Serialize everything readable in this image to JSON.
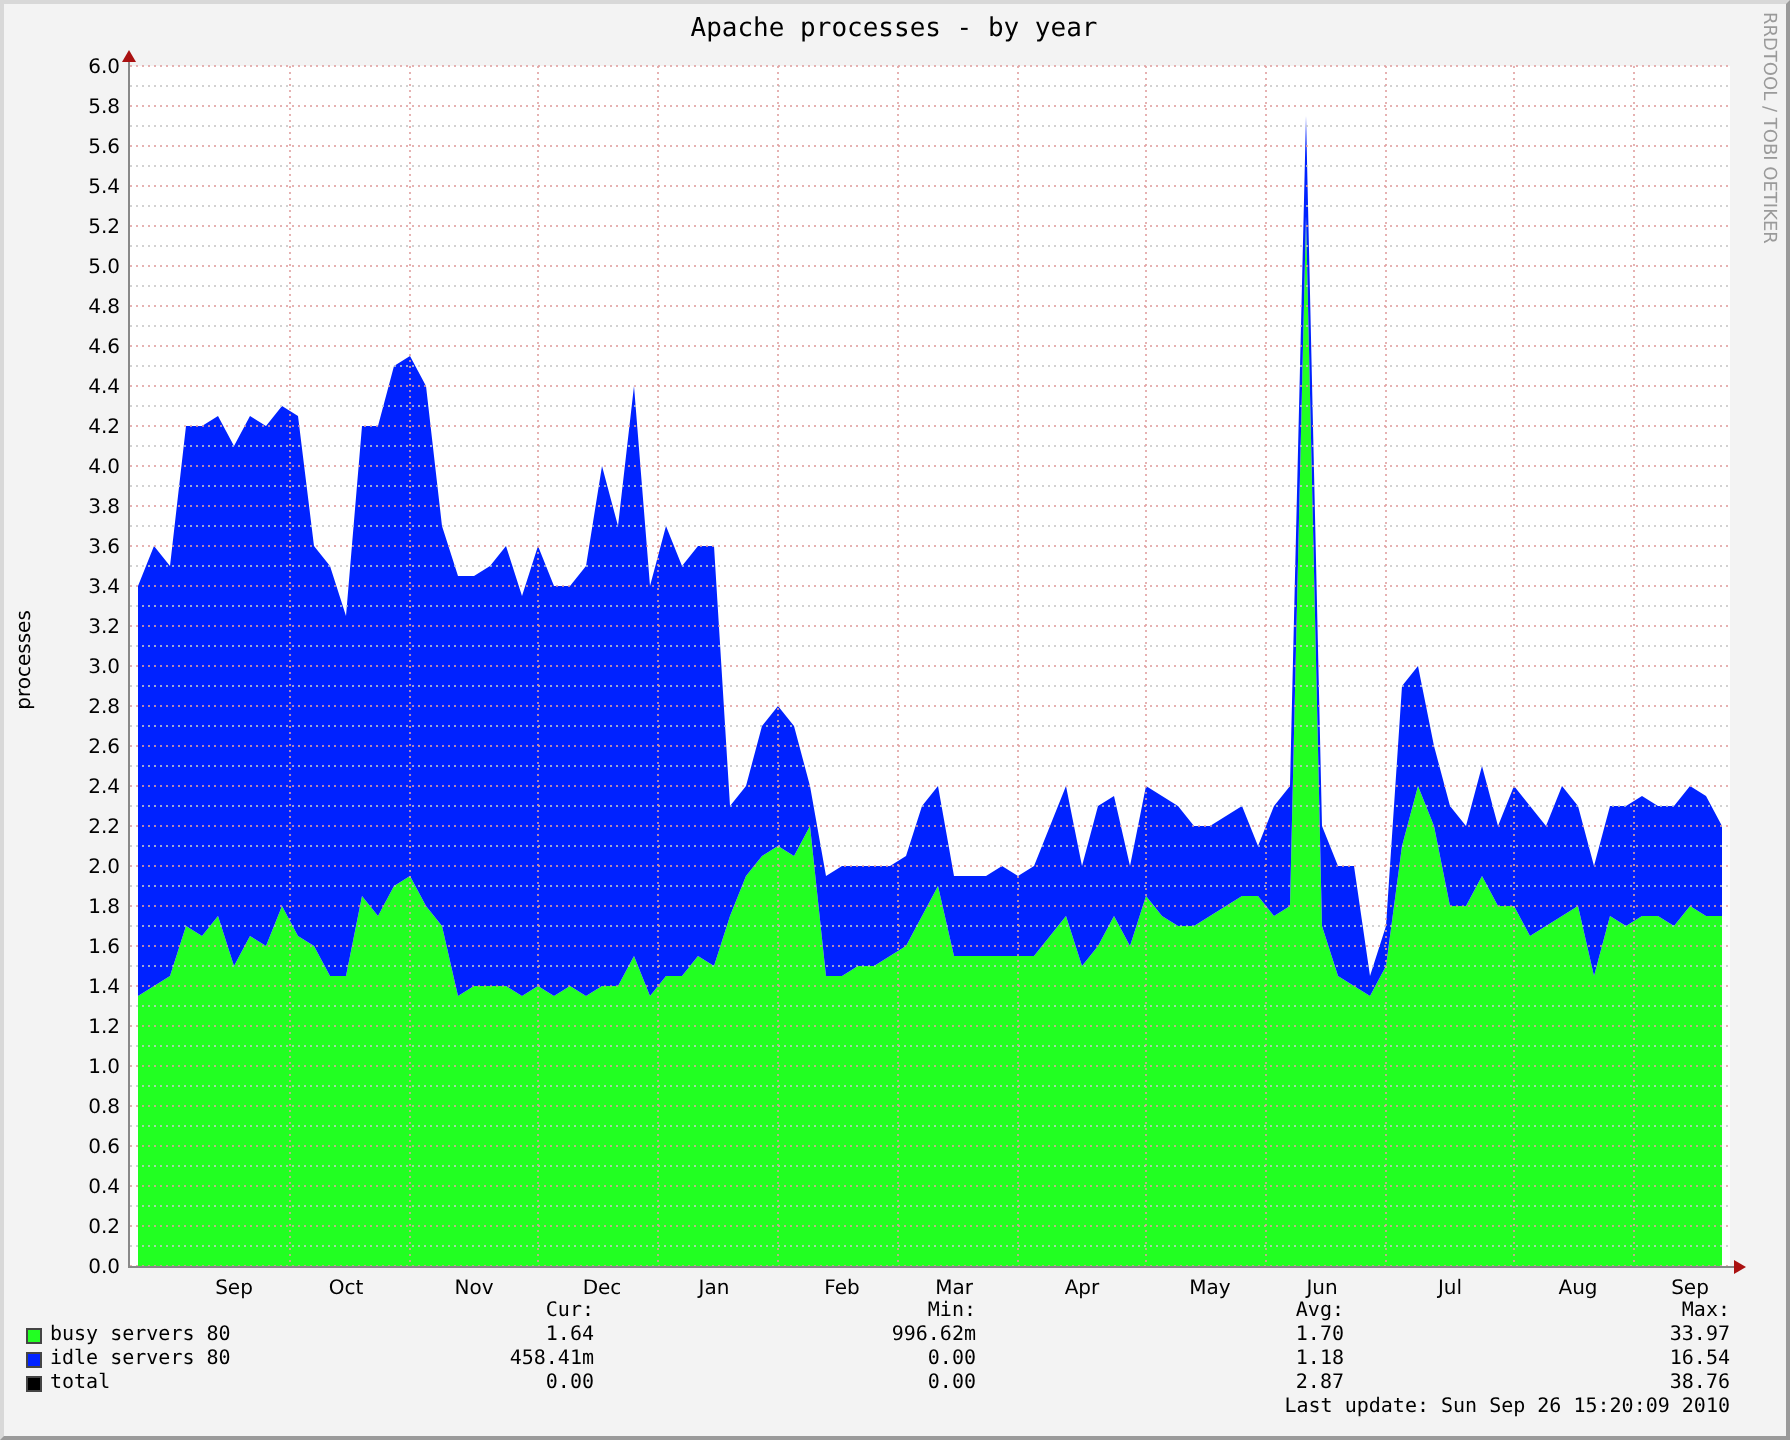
{
  "title": "Apache processes - by year",
  "credit": "RRDTOOL / TOBI OETIKER",
  "chart_data": {
    "type": "area",
    "stacked": true,
    "ylabel": "processes",
    "categories": [
      null,
      null,
      null,
      null,
      null,
      null,
      "Sep",
      null,
      null,
      null,
      null,
      null,
      null,
      "Oct",
      null,
      null,
      null,
      null,
      null,
      null,
      null,
      "Nov",
      null,
      null,
      null,
      null,
      null,
      null,
      null,
      "Dec",
      null,
      null,
      null,
      null,
      null,
      null,
      "Jan",
      null,
      null,
      null,
      null,
      null,
      null,
      null,
      "Feb",
      null,
      null,
      null,
      null,
      null,
      null,
      "Mar",
      null,
      null,
      null,
      null,
      null,
      null,
      null,
      "Apr",
      null,
      null,
      null,
      null,
      null,
      null,
      null,
      "May",
      null,
      null,
      null,
      null,
      null,
      null,
      "Jun",
      null,
      null,
      null,
      null,
      null,
      null,
      null,
      "Jul",
      null,
      null,
      null,
      null,
      null,
      null,
      null,
      "Aug",
      null,
      null,
      null,
      null,
      null,
      null,
      "Sep",
      null,
      null
    ],
    "ylim": [
      0,
      6
    ],
    "grid": true,
    "yticks": [
      {
        "value": 0,
        "label": "0.0"
      },
      {
        "value": 0.2,
        "label": "0.2"
      },
      {
        "value": 0.4,
        "label": "0.4"
      },
      {
        "value": 0.6,
        "label": "0.6"
      },
      {
        "value": 0.8,
        "label": "0.8"
      },
      {
        "value": 1,
        "label": "1.0"
      },
      {
        "value": 1.2,
        "label": "1.2"
      },
      {
        "value": 1.4,
        "label": "1.4"
      },
      {
        "value": 1.6,
        "label": "1.6"
      },
      {
        "value": 1.8,
        "label": "1.8"
      },
      {
        "value": 2,
        "label": "2.0"
      },
      {
        "value": 2.2,
        "label": "2.2"
      },
      {
        "value": 2.4,
        "label": "2.4"
      },
      {
        "value": 2.6,
        "label": "2.6"
      },
      {
        "value": 2.8,
        "label": "2.8"
      },
      {
        "value": 3,
        "label": "3.0"
      },
      {
        "value": 3.2,
        "label": "3.2"
      },
      {
        "value": 3.4,
        "label": "3.4"
      },
      {
        "value": 3.6,
        "label": "3.6"
      },
      {
        "value": 3.8,
        "label": "3.8"
      },
      {
        "value": 4,
        "label": "4.0"
      },
      {
        "value": 4.2,
        "label": "4.2"
      },
      {
        "value": 4.4,
        "label": "4.4"
      },
      {
        "value": 4.6,
        "label": "4.6"
      },
      {
        "value": 4.8,
        "label": "4.8"
      },
      {
        "value": 5,
        "label": "5.0"
      },
      {
        "value": 5.2,
        "label": "5.2"
      },
      {
        "value": 5.4,
        "label": "5.4"
      },
      {
        "value": 5.6,
        "label": "5.6"
      },
      {
        "value": 5.8,
        "label": "5.8"
      },
      {
        "value": 6,
        "label": "6.0"
      }
    ],
    "series": [
      {
        "name": "busy servers 80",
        "color": "#22ff22",
        "values": [
          1.35,
          1.4,
          1.45,
          1.7,
          1.65,
          1.75,
          1.5,
          1.65,
          1.6,
          1.8,
          1.65,
          1.6,
          1.45,
          1.45,
          1.85,
          1.75,
          1.9,
          1.95,
          1.8,
          1.7,
          1.35,
          1.4,
          1.4,
          1.4,
          1.35,
          1.4,
          1.35,
          1.4,
          1.35,
          1.4,
          1.4,
          1.55,
          1.35,
          1.45,
          1.45,
          1.55,
          1.5,
          1.75,
          1.95,
          2.05,
          2.1,
          2.05,
          2.2,
          1.45,
          1.45,
          1.5,
          1.5,
          1.55,
          1.6,
          1.75,
          1.9,
          1.55,
          1.55,
          1.55,
          1.55,
          1.55,
          1.55,
          1.65,
          1.75,
          1.5,
          1.6,
          1.75,
          1.6,
          1.85,
          1.75,
          1.7,
          1.7,
          1.75,
          1.8,
          1.85,
          1.85,
          1.75,
          1.8,
          5.25,
          1.7,
          1.45,
          1.4,
          1.35,
          1.5,
          2.1,
          2.4,
          2.2,
          1.8,
          1.8,
          1.95,
          1.8,
          1.8,
          1.65,
          1.7,
          1.75,
          1.8,
          1.45,
          1.75,
          1.7,
          1.75,
          1.75,
          1.7,
          1.8,
          1.75,
          1.75
        ]
      },
      {
        "name": "idle servers 80",
        "color": "#0022ff",
        "values": [
          2.05,
          2.2,
          2.05,
          2.5,
          2.55,
          2.5,
          2.6,
          2.6,
          2.6,
          2.5,
          2.6,
          2.0,
          2.05,
          1.8,
          2.35,
          2.45,
          2.6,
          2.6,
          2.6,
          2.0,
          2.1,
          2.05,
          2.1,
          2.2,
          2.0,
          2.2,
          2.05,
          2.0,
          2.15,
          2.6,
          2.3,
          2.85,
          2.05,
          2.25,
          2.05,
          2.05,
          2.1,
          0.55,
          0.45,
          0.65,
          0.7,
          0.65,
          0.2,
          0.5,
          0.55,
          0.5,
          0.5,
          0.45,
          0.45,
          0.55,
          0.5,
          0.4,
          0.4,
          0.4,
          0.45,
          0.4,
          0.45,
          0.55,
          0.65,
          0.5,
          0.7,
          0.6,
          0.4,
          0.55,
          0.6,
          0.6,
          0.5,
          0.45,
          0.45,
          0.45,
          0.25,
          0.55,
          0.6,
          0.5,
          0.5,
          0.55,
          0.6,
          0.1,
          0.2,
          0.8,
          0.6,
          0.4,
          0.5,
          0.4,
          0.55,
          0.4,
          0.6,
          0.65,
          0.5,
          0.65,
          0.5,
          0.55,
          0.55,
          0.6,
          0.6,
          0.55,
          0.6,
          0.6,
          0.6,
          0.45
        ]
      }
    ]
  },
  "legend": {
    "columns": [
      "Cur:",
      "Min:",
      "Avg:",
      "Max:"
    ],
    "rows": [
      {
        "values": [
          "1.64",
          "996.62m",
          "1.70",
          "33.97"
        ]
      },
      {
        "values": [
          "458.41m",
          "0.00",
          "1.18",
          "16.54"
        ]
      },
      {
        "label": "total",
        "color": "#000000",
        "values": [
          "0.00",
          "0.00",
          "2.87",
          "38.76"
        ]
      }
    ]
  },
  "last_update": "Last update: Sun Sep 26 15:20:09 2010"
}
